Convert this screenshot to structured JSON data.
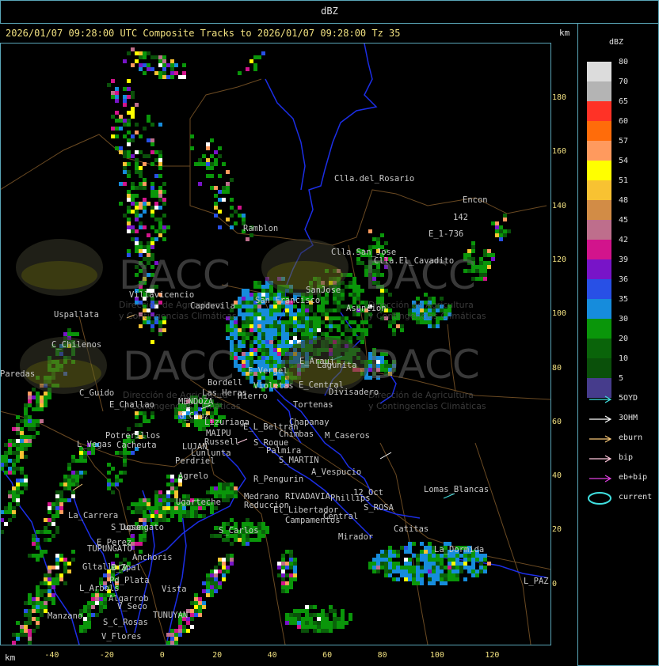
{
  "window_title": "dBZ",
  "header": "2026/01/07 09:28:00 UTC Composite Tracks to 2026/01/07 09:28:00 Tz 35",
  "km_top": "km",
  "km_bottom": "km",
  "legend": {
    "title": "dBZ",
    "scale": [
      {
        "label": "80",
        "color": "#dcdcdc"
      },
      {
        "label": "70",
        "color": "#b4b4b4"
      },
      {
        "label": "65",
        "color": "#ff3226"
      },
      {
        "label": "60",
        "color": "#ff6c0a"
      },
      {
        "label": "57",
        "color": "#ff9a5e"
      },
      {
        "label": "54",
        "color": "#ffff00"
      },
      {
        "label": "51",
        "color": "#f8c232"
      },
      {
        "label": "48",
        "color": "#d28c46"
      },
      {
        "label": "45",
        "color": "#be6e8c"
      },
      {
        "label": "42",
        "color": "#d2148c"
      },
      {
        "label": "39",
        "color": "#7814c8"
      },
      {
        "label": "36",
        "color": "#2850e6"
      },
      {
        "label": "35",
        "color": "#168cdc"
      },
      {
        "label": "30",
        "color": "#0a960a"
      },
      {
        "label": "20",
        "color": "#0a640a"
      },
      {
        "label": "10",
        "color": "#0a500a"
      },
      {
        "label": "5",
        "color": "#463c8c"
      }
    ],
    "tracks": [
      {
        "label": "5OYD",
        "color": "#40e0e0"
      },
      {
        "label": "3OHM",
        "color": "#ffffff"
      },
      {
        "label": "eburn",
        "color": "#f8c878"
      },
      {
        "label": "bip",
        "color": "#ffc8dc"
      },
      {
        "label": "eb+bip",
        "color": "#e040e0"
      },
      {
        "label": "current",
        "color": "#40e0e0"
      }
    ]
  },
  "y_ticks": [
    "180",
    "160",
    "140",
    "120",
    "100",
    "80",
    "60",
    "40",
    "20",
    "0"
  ],
  "x_ticks": [
    "-40",
    "-20",
    "0",
    "20",
    "40",
    "60",
    "80",
    "100",
    "120"
  ],
  "watermark": {
    "name": "DACC",
    "subtitle_1": "Dirección de Agricultura",
    "subtitle_2": "y Contingencias Climáticas"
  },
  "places": [
    "Clla.del_Rosario",
    "Encon",
    "142",
    "E_1-736",
    "Ramblon",
    "Clla.San_Jose",
    "Clla.El_Cavadito",
    "Villavicencio",
    "Uspallata",
    "Capdevila",
    "San_Francisco",
    "SanJose",
    "Asuncion",
    "C_Chilenos",
    "E_Vergel",
    "Bordell",
    "Violetas",
    "E_Arauj",
    "Lagunita",
    "E_Central",
    "Divisadero",
    "C_Guido",
    "E_Challao",
    "MENDOZA",
    "Las_Heras",
    "Hierro",
    "Tortenas",
    "Lizuriaga",
    "G_Cruz",
    "E_L_Beltran",
    "Chapanay",
    "Potrerillos",
    "L_Vegas",
    "Cacheuta",
    "MAIPU",
    "Russell",
    "LUJAN",
    "Lunlunta",
    "S_Roque",
    "Chimbas",
    "M_Caseros",
    "Palmira",
    "S_MARTIN",
    "Perdriel",
    "Agrelo",
    "R_Pengurin",
    "A_Vespucio",
    "Medrano",
    "Reduccion",
    "RIVADAVIA",
    "Phillips",
    "12_Oct",
    "Lomas_Blancas",
    "S_ROSA",
    "La_Carrera",
    "Ugarteche",
    "Tupungato",
    "S_Jose",
    "El_Libertador",
    "Campamentos",
    "Central",
    "Catitas",
    "E_Perez",
    "TUPUNGATO",
    "S_Carlos",
    "Mirador",
    "La_Dormida",
    "Gltallary",
    "E_Zpal",
    "Anchoris",
    "L_Arbols",
    "Pd_Plata",
    "Vista",
    "L_PAZ",
    "Algarrob",
    "V_Seco",
    "TUNUYAN",
    "S_C_Rosas",
    "V_Flores",
    "Manzano",
    "Paredas"
  ]
}
